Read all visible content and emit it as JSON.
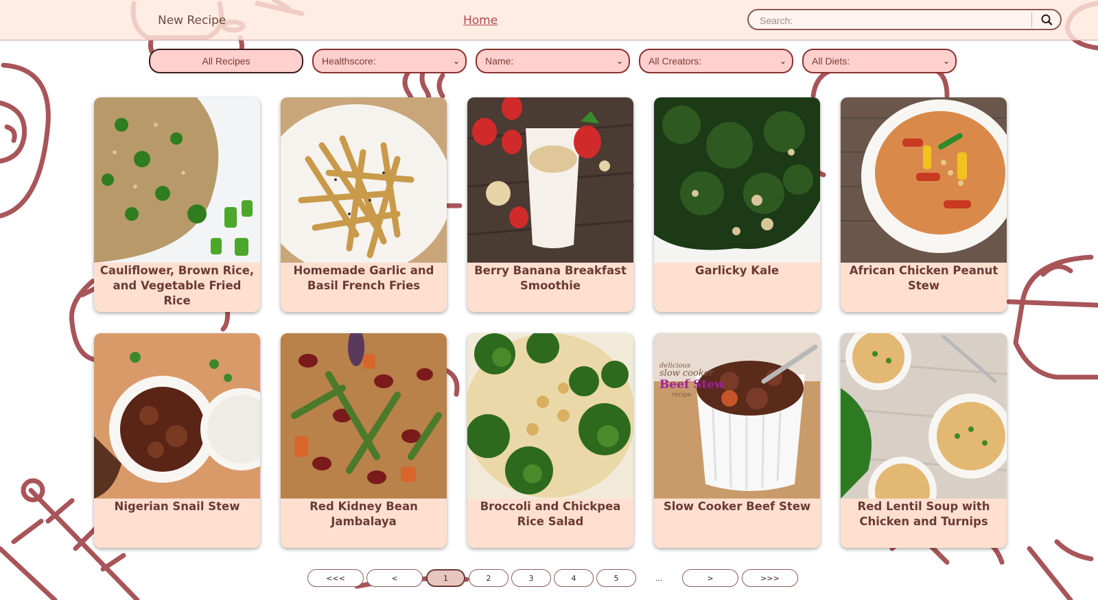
{
  "header": {
    "new_recipe": "New Recipe",
    "home": "Home",
    "search_placeholder": "Search:"
  },
  "filters": {
    "all_recipes": "All Recipes",
    "healthscore": "Healthscore:",
    "name": "Name:",
    "creators": "All Creators:",
    "diets": "All Diets:"
  },
  "recipes": [
    {
      "title": "Cauliflower, Brown Rice, and Vegetable Fried Rice",
      "image": "fried-rice"
    },
    {
      "title": "Homemade Garlic and Basil French Fries",
      "image": "french-fries"
    },
    {
      "title": "Berry Banana Breakfast Smoothie",
      "image": "smoothie"
    },
    {
      "title": "Garlicky Kale",
      "image": "kale"
    },
    {
      "title": "African Chicken Peanut Stew",
      "image": "peanut-stew"
    },
    {
      "title": "Nigerian Snail Stew",
      "image": "snail-stew"
    },
    {
      "title": "Red Kidney Bean Jambalaya",
      "image": "jambalaya"
    },
    {
      "title": "Broccoli and Chickpea Rice Salad",
      "image": "rice-salad"
    },
    {
      "title": "Slow Cooker Beef Stew",
      "image": "beef-stew"
    },
    {
      "title": "Red Lentil Soup with Chicken and Turnips",
      "image": "lentil-soup"
    }
  ],
  "photo_text": {
    "beef_stew_line1": "delicious",
    "beef_stew_line2": "slow cooker",
    "beef_stew_line3": "Beef Stew",
    "beef_stew_line4": "recipe"
  },
  "pagination": {
    "first": "<<<",
    "prev": "<",
    "pages": [
      "1",
      "2",
      "3",
      "4",
      "5"
    ],
    "current": "1",
    "ellipsis": "...",
    "next": ">",
    "last": ">>>"
  },
  "colors": {
    "header_bg": "#ffe8dc",
    "card_bg": "#ffe0d0",
    "accent": "#8a2f2f",
    "title_text": "#6b3a34",
    "doodle": "#a8555a"
  },
  "icons": {
    "search": "search-icon"
  }
}
